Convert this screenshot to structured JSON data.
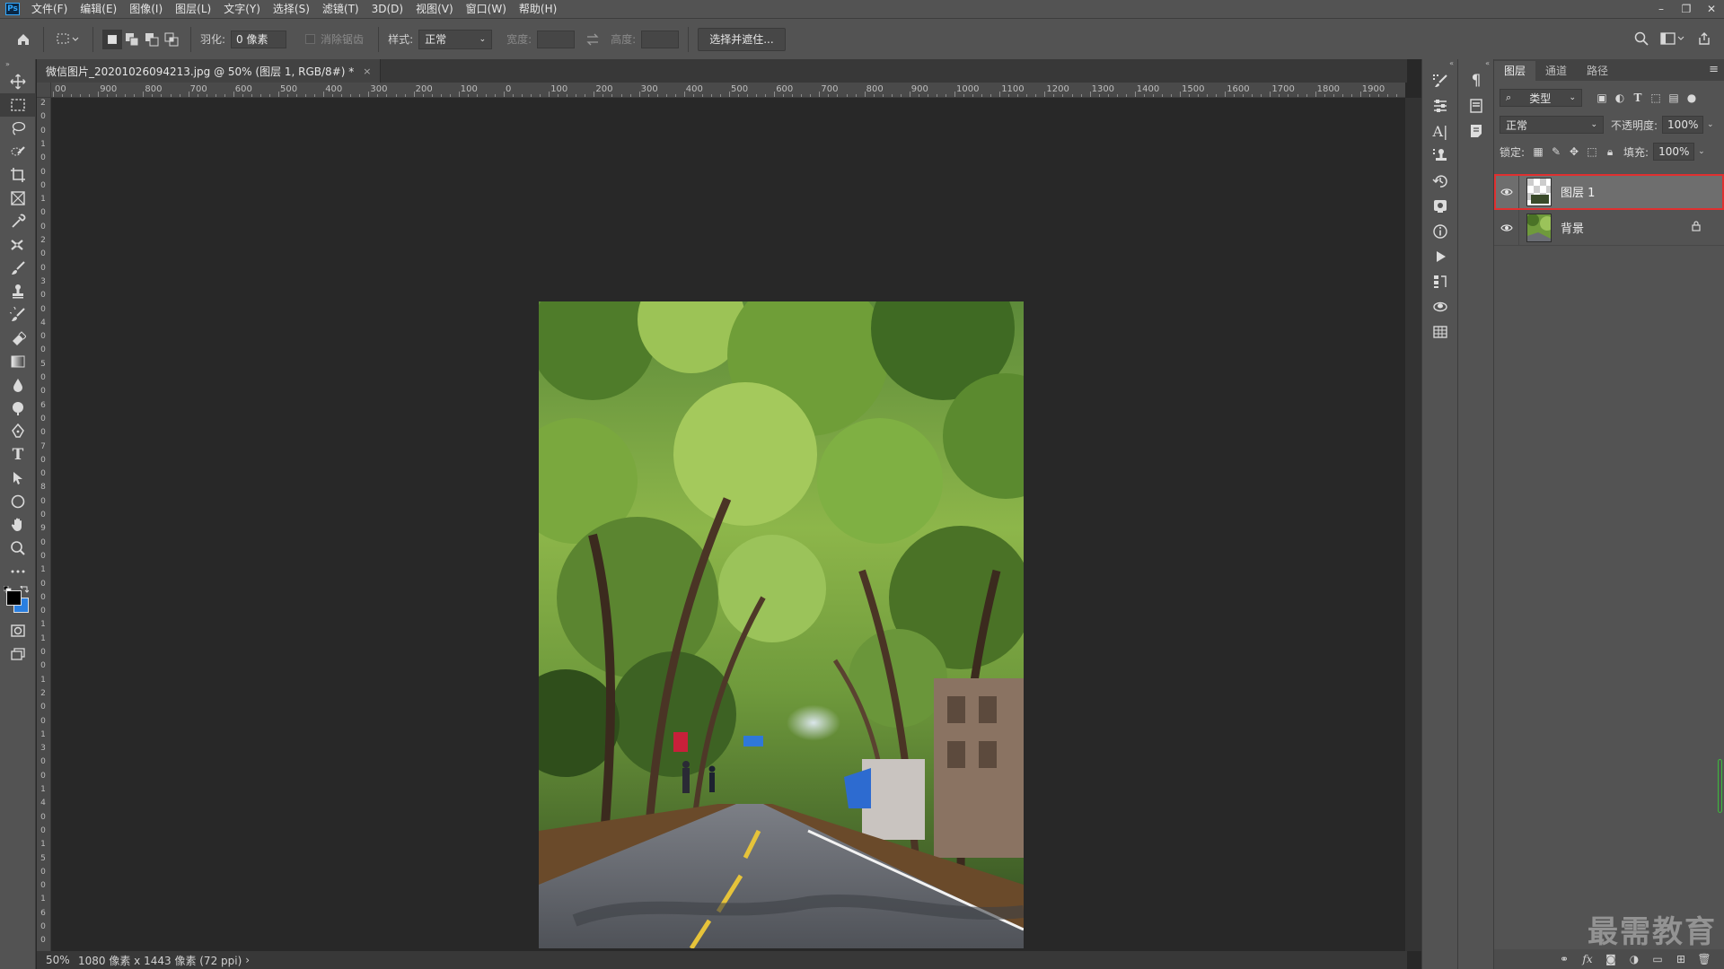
{
  "app": {
    "logo": "Ps",
    "accent": "#31a8ff",
    "highlight": "#e03030"
  },
  "menu": {
    "items": [
      "文件(F)",
      "编辑(E)",
      "图像(I)",
      "图层(L)",
      "文字(Y)",
      "选择(S)",
      "滤镜(T)",
      "3D(D)",
      "视图(V)",
      "窗口(W)",
      "帮助(H)"
    ]
  },
  "window_controls": {
    "minimize": "–",
    "restore": "❐",
    "close": "✕"
  },
  "options": {
    "feather_label": "羽化:",
    "feather_value": "0 像素",
    "antialias_label": "消除锯齿",
    "style_label": "样式:",
    "style_value": "正常",
    "width_label": "宽度:",
    "height_label": "高度:",
    "select_mask_button": "选择并遮住..."
  },
  "document": {
    "tab_title": "微信图片_20201026094213.jpg @ 50% (图层 1, RGB/8#) *",
    "close_glyph": "×",
    "ruler_h_labels": [
      "00",
      "900",
      "800",
      "700",
      "600",
      "500",
      "400",
      "300",
      "200",
      "100",
      "0",
      "100",
      "200",
      "300",
      "400",
      "500",
      "600",
      "700",
      "800",
      "900",
      "1000",
      "1100",
      "1200",
      "1300",
      "1400",
      "1500",
      "1600",
      "1700",
      "1800",
      "1900",
      "200"
    ],
    "ruler_v_labels": [
      "2",
      "0",
      "0",
      "1",
      "0",
      "0",
      "0",
      "1",
      "0",
      "0",
      "2",
      "0",
      "0",
      "3",
      "0",
      "0",
      "4",
      "0",
      "0",
      "5",
      "0",
      "0",
      "6",
      "0",
      "0",
      "7",
      "0",
      "0",
      "8",
      "0",
      "0",
      "9",
      "0",
      "0",
      "1",
      "0",
      "0",
      "0",
      "1",
      "1",
      "0",
      "0",
      "1",
      "2",
      "0",
      "0",
      "1",
      "3",
      "0",
      "0",
      "1",
      "4",
      "0",
      "0",
      "1",
      "5",
      "0",
      "0",
      "1",
      "6",
      "0",
      "0"
    ]
  },
  "status": {
    "zoom": "50%",
    "info": "1080 像素 x 1443 像素 (72 ppi)",
    "arrow": "›"
  },
  "layers_panel": {
    "tabs": [
      "图层",
      "通道",
      "路径"
    ],
    "filter_kind": "类型",
    "blend_mode": "正常",
    "opacity_label": "不透明度:",
    "opacity_value": "100%",
    "lock_label": "锁定:",
    "fill_label": "填充:",
    "fill_value": "100%",
    "layers": [
      {
        "name": "图层 1",
        "selected": true,
        "locked": false
      },
      {
        "name": "背景",
        "selected": false,
        "locked": true
      }
    ]
  },
  "watermark": "最需教育"
}
